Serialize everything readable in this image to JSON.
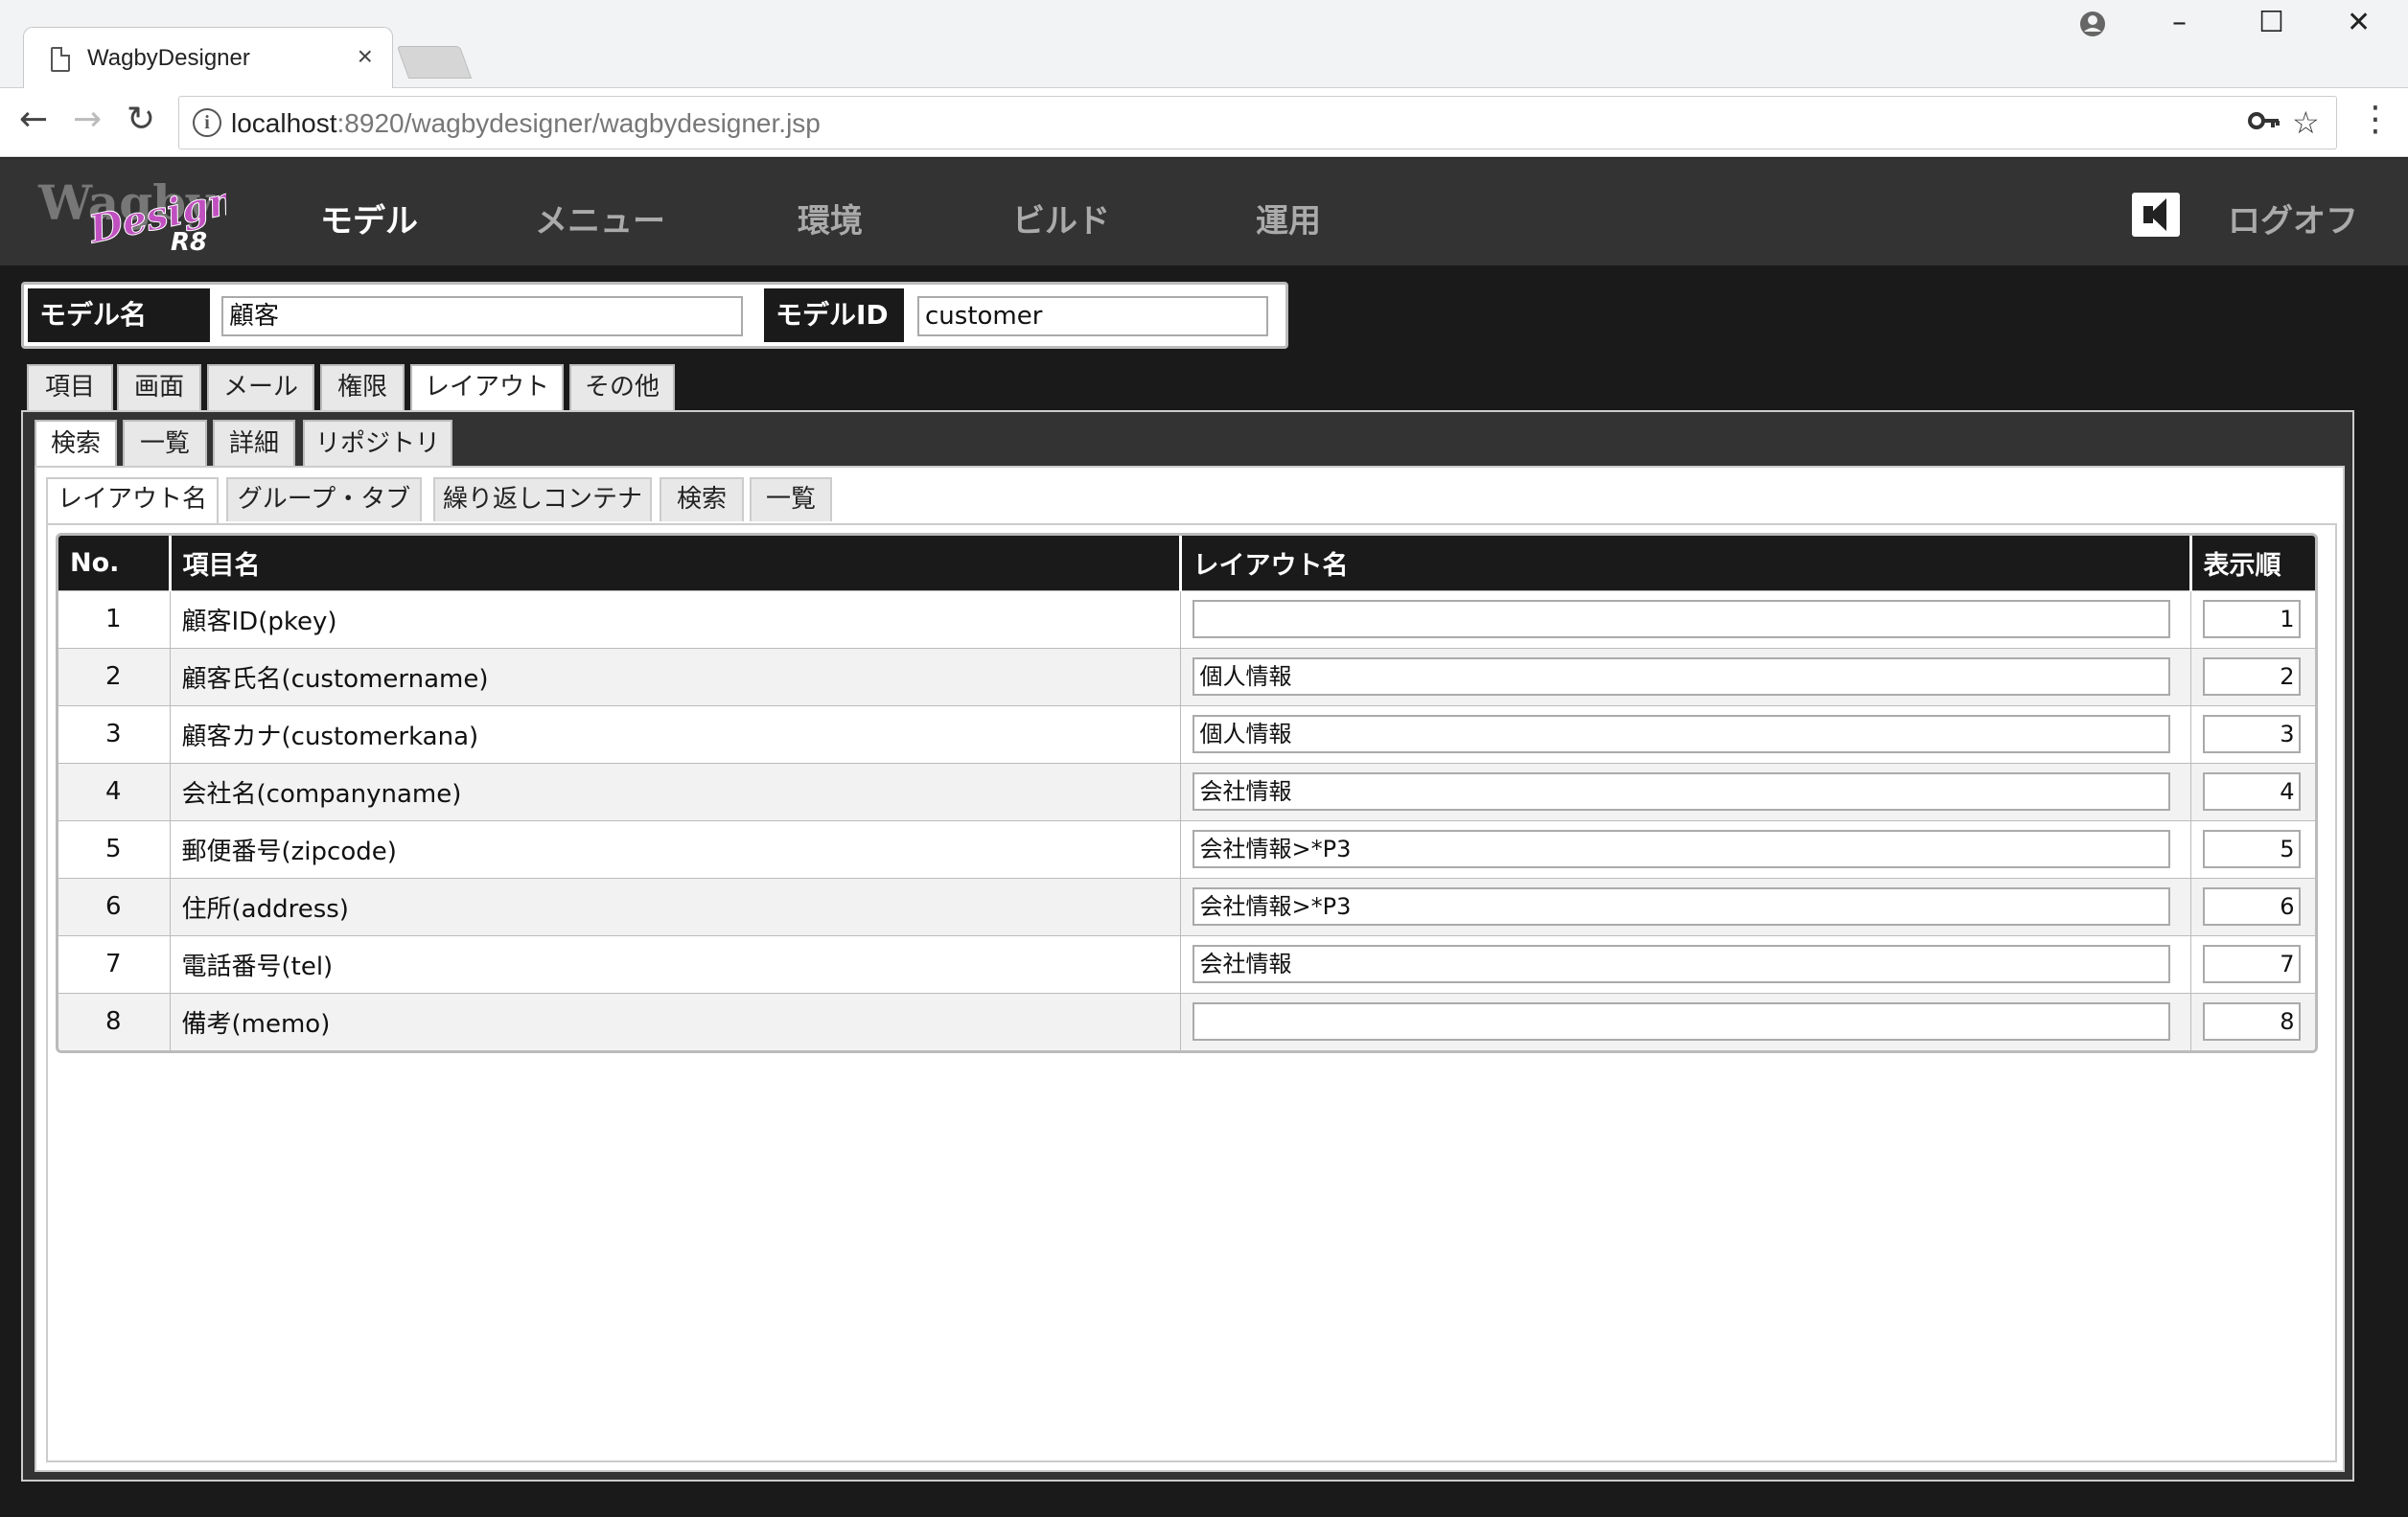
{
  "browser": {
    "tab_title": "WagbyDesigner",
    "tab_close": "×",
    "url_host": "localhost",
    "url_rest": ":8920/wagbydesigner/wagbydesigner.jsp",
    "profile_icon": "account-circle-icon",
    "minimize": "–",
    "maximize": "☐",
    "close": "✕"
  },
  "header": {
    "logo_main": "Wagby",
    "logo_script": "Designer",
    "logo_version": "R8",
    "nav": [
      "モデル",
      "メニュー",
      "環境",
      "ビルド",
      "運用"
    ],
    "active_nav": "モデル",
    "logoff": "ログオフ"
  },
  "model": {
    "name_label": "モデル名",
    "name_value": "顧客",
    "id_label": "モデルID",
    "id_value": "customer"
  },
  "tabs_level1": [
    "項目",
    "画面",
    "メール",
    "権限",
    "レイアウト",
    "その他"
  ],
  "tabs_level1_active": "レイアウト",
  "tabs_level2": [
    "検索",
    "一覧",
    "詳細",
    "リポジトリ"
  ],
  "tabs_level2_active": "検索",
  "tabs_level3": [
    "レイアウト名",
    "グループ・タブ",
    "繰り返しコンテナ",
    "検索",
    "一覧"
  ],
  "tabs_level3_active": "レイアウト名",
  "table": {
    "headers": [
      "No.",
      "項目名",
      "レイアウト名",
      "表示順"
    ],
    "rows": [
      {
        "no": "1",
        "item": "顧客ID(pkey)",
        "layout": "",
        "order": "1"
      },
      {
        "no": "2",
        "item": "顧客氏名(customername)",
        "layout": "個人情報",
        "order": "2"
      },
      {
        "no": "3",
        "item": "顧客カナ(customerkana)",
        "layout": "個人情報",
        "order": "3"
      },
      {
        "no": "4",
        "item": "会社名(companyname)",
        "layout": "会社情報",
        "order": "4"
      },
      {
        "no": "5",
        "item": "郵便番号(zipcode)",
        "layout": "会社情報>*P3",
        "order": "5"
      },
      {
        "no": "6",
        "item": "住所(address)",
        "layout": "会社情報>*P3",
        "order": "6"
      },
      {
        "no": "7",
        "item": "電話番号(tel)",
        "layout": "会社情報",
        "order": "7"
      },
      {
        "no": "8",
        "item": "備考(memo)",
        "layout": "",
        "order": "8"
      }
    ]
  }
}
